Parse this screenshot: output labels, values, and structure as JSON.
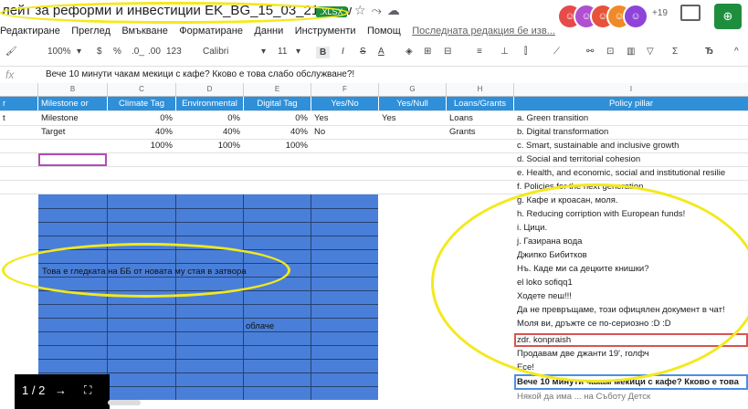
{
  "title": {
    "doc_name": "лейт за реформи и инвестиции EK_BG_15_03_21_new",
    "format_badge": ".XLSX",
    "icons": [
      "star-icon",
      "move-icon",
      "cloud-icon"
    ],
    "avatar_count": "+19",
    "share_label": "⊕"
  },
  "menu": {
    "items": [
      "Редактиране",
      "Преглед",
      "Вмъкване",
      "Форматиране",
      "Данни",
      "Инструменти",
      "Помощ"
    ],
    "last_edit": "Последната редакция бе изв..."
  },
  "toolbar": {
    "zoom": "100%",
    "currency": "$",
    "percent": "%",
    "dec_less": ".0_",
    "dec_more": ".00",
    "format": "123",
    "font": "Calibri",
    "size": "11"
  },
  "formula": {
    "label": "fx",
    "content": "Вече 10 минути чакам мекици с кафе? Кково е това слабо обслужване?!"
  },
  "columns": [
    "B",
    "C",
    "D",
    "E",
    "F",
    "G",
    "H",
    "I"
  ],
  "header_row": {
    "a": "r",
    "b": "Milestone or",
    "c": "Climate Tag",
    "d": "Environmental",
    "e": "Digital Tag",
    "f": "Yes/No",
    "g": "Yes/Null",
    "h": "Loans/Grants",
    "i": "Policy pillar"
  },
  "rows": [
    {
      "a": "t",
      "b": "Milestone",
      "c": "0%",
      "d": "0%",
      "e": "0%",
      "f": "Yes",
      "g": "Yes",
      "h": "Loans",
      "i": "a. Green transition"
    },
    {
      "a": "",
      "b": "Target",
      "c": "40%",
      "d": "40%",
      "e": "40%",
      "f": "No",
      "g": "",
      "h": "Grants",
      "i": "b. Digital transformation"
    },
    {
      "a": "",
      "b": "",
      "c": "100%",
      "d": "100%",
      "e": "100%",
      "f": "",
      "g": "",
      "h": "",
      "i": "c. Smart, sustainable and inclusive growth"
    },
    {
      "i": "d. Social and territorial cohesion"
    },
    {
      "i": "e. Health, and economic, social and institutional resilie"
    },
    {
      "i": "f. Policies for the next generation"
    },
    {
      "i": "g. Кафе и кроасан, моля."
    },
    {
      "i": "h. Reducing corription with European funds!"
    },
    {
      "i": "i. Цици."
    },
    {
      "i": "j. Газирана вода"
    },
    {
      "i": "Джипко Бибитков"
    },
    {
      "i": "Нъ. Каде ми са децките книшки?"
    },
    {
      "i": "el loko sofiqq1"
    },
    {
      "i": "Ходете пеш!!!"
    },
    {
      "i": "Да не превръщаме, този офицялен документ в чат!"
    },
    {
      "i": "Моля ви, дръжте се по-сериозно :D :D"
    },
    {
      "i": "zdr. konpraish"
    },
    {
      "i": "Продавам две джанти 19', голфч"
    },
    {
      "i": "Есе!"
    },
    {
      "i": "Вече 10 минути чакам мекици с кафе? Кково е това"
    },
    {
      "i": "Някой да има ... на Съботу Детск"
    }
  ],
  "overlays": {
    "bb_text": "Това е гледката на ББ от новата му стая в затвора",
    "cloud_text": "облаче"
  },
  "pager": {
    "page": "1 / 2",
    "next": "→",
    "fullscreen": "⛶"
  },
  "colors": {
    "header_blue": "#2f8fd8",
    "block_blue": "#4a7fd9",
    "highlight_yellow": "#f3e91d",
    "share_green": "#1e8e3e"
  }
}
